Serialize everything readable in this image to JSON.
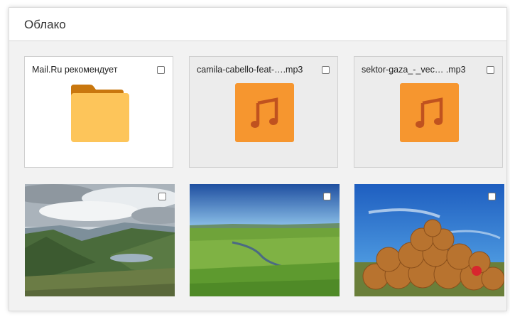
{
  "header": {
    "title": "Облако"
  },
  "files": [
    {
      "name": "Mail.Ru рекомендует",
      "kind": "folder",
      "icon": "folder-icon"
    },
    {
      "name": "camila-cabello-feat-….mp3",
      "kind": "audio",
      "icon": "music-note-icon"
    },
    {
      "name": "sektor-gaza_-_vec…   .mp3",
      "kind": "audio",
      "icon": "music-note-icon"
    }
  ],
  "photos": [
    {
      "kind": "image",
      "subject": "mountain-lake-landscape"
    },
    {
      "kind": "image",
      "subject": "green-meadow-landscape"
    },
    {
      "kind": "image",
      "subject": "hay-bales-landscape"
    }
  ],
  "colors": {
    "audio_tile": "#f6962f",
    "audio_note": "#c0521f",
    "folder_front": "#fdc55a",
    "folder_back": "#c9770e"
  }
}
